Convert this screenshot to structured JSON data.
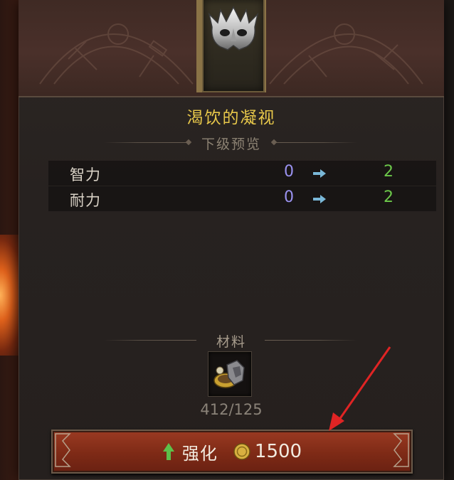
{
  "item": {
    "name": "渴饮的凝视",
    "icon": "spiked-mask-icon"
  },
  "preview": {
    "heading": "下级预览",
    "stats": [
      {
        "label": "智力",
        "from": "0",
        "to": "2"
      },
      {
        "label": "耐力",
        "from": "0",
        "to": "2"
      }
    ]
  },
  "materials": {
    "heading": "材料",
    "icon": "crafting-material-icon",
    "count": "412/125"
  },
  "upgrade_button": {
    "label": "强化",
    "cost": "1500",
    "cost_icon": "gold-coin-icon",
    "up_icon": "up-arrow-icon"
  },
  "colors": {
    "title": "#e8c84a",
    "stat_from": "#9a92f0",
    "stat_to": "#6cc84a",
    "button": "#8a2f1a",
    "annotation_arrow": "#e02424"
  }
}
